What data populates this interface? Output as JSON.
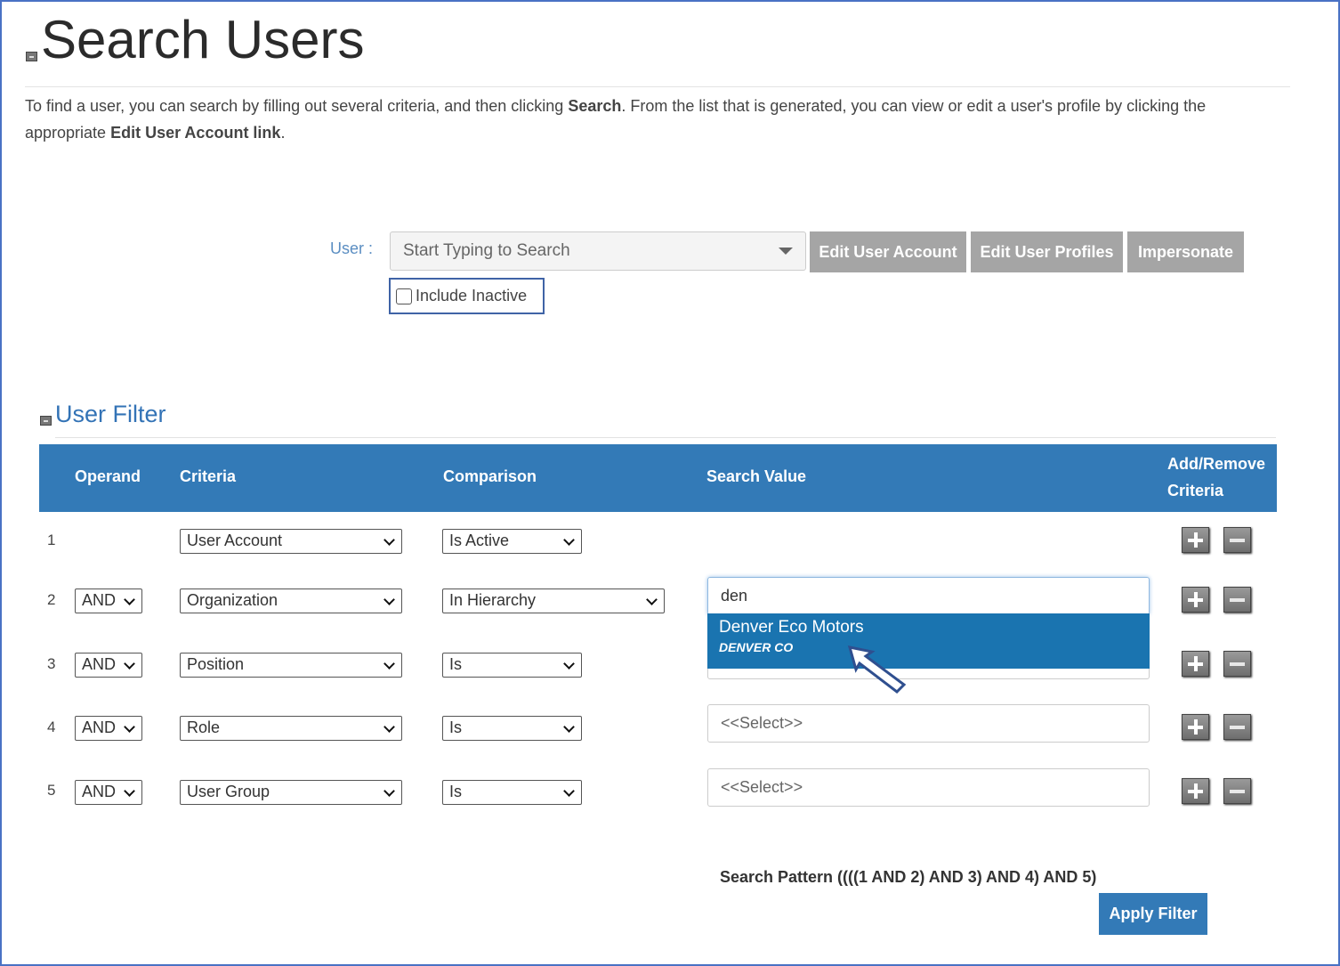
{
  "page": {
    "title": "Search Users",
    "intro": {
      "p1": "To find a user, you can search by filling out several criteria, and then clicking ",
      "b1": "Search",
      "p2": ". From the list that is generated, you can view or edit a user's profile by clicking the appropriate ",
      "b2": "Edit User Account link",
      "p3": "."
    }
  },
  "user_search": {
    "label": "User :",
    "placeholder": "Start Typing to Search",
    "edit_account": "Edit User Account",
    "edit_profiles": "Edit User Profiles",
    "impersonate": "Impersonate",
    "include_inactive": "Include Inactive",
    "include_inactive_checked": false
  },
  "filter": {
    "title": "User Filter",
    "headers": {
      "operand": "Operand",
      "criteria": "Criteria",
      "comparison": "Comparison",
      "search_value": "Search Value",
      "add_remove_1": "Add/Remove",
      "add_remove_2": "Criteria"
    },
    "rows": [
      {
        "num": "1",
        "operand": "",
        "criteria": "User Account",
        "comparison": "Is Active",
        "value": ""
      },
      {
        "num": "2",
        "operand": "AND",
        "criteria": "Organization",
        "comparison": "In Hierarchy",
        "value": "den"
      },
      {
        "num": "3",
        "operand": "AND",
        "criteria": "Position",
        "comparison": "Is",
        "value": ""
      },
      {
        "num": "4",
        "operand": "AND",
        "criteria": "Role",
        "comparison": "Is",
        "value": "<<Select>>"
      },
      {
        "num": "5",
        "operand": "AND",
        "criteria": "User Group",
        "comparison": "Is",
        "value": "<<Select>>"
      }
    ],
    "suggestion": {
      "name": "Denver Eco Motors",
      "sub": "DENVER CO"
    },
    "pattern": "Search Pattern ((((1 AND 2) AND 3) AND 4) AND 5)",
    "apply": "Apply Filter"
  },
  "colors": {
    "header": "#337ab7",
    "highlight": "#1a74b0",
    "button_gray": "#a5a5a5"
  }
}
